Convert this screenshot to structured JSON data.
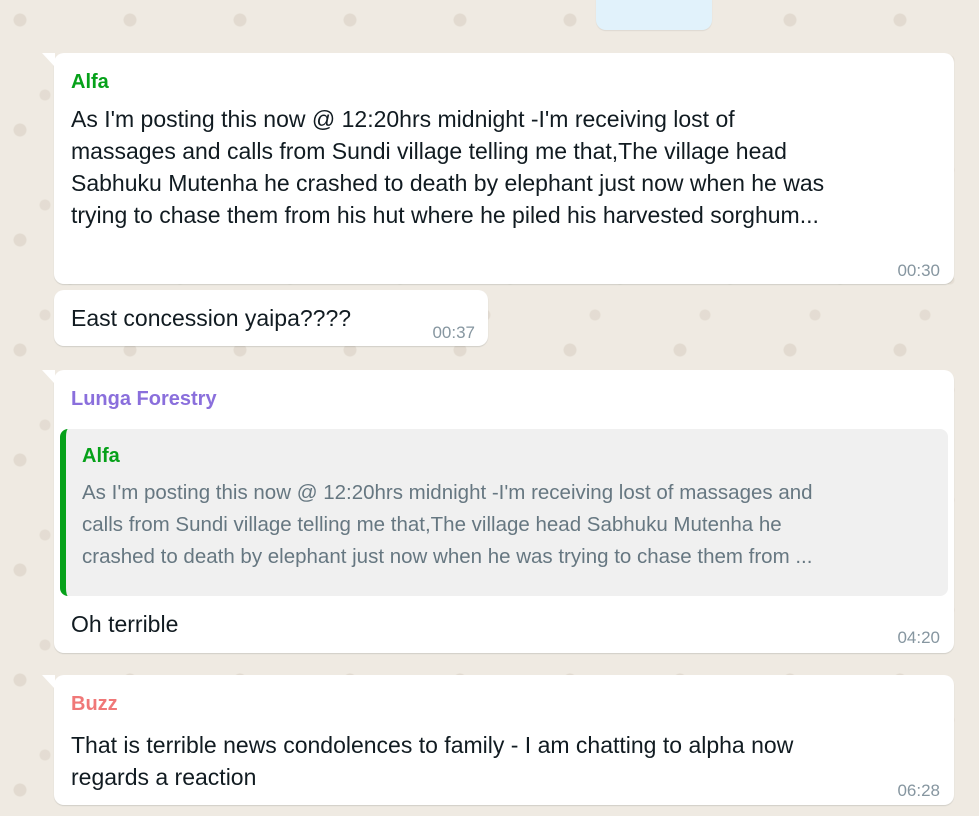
{
  "colors": {
    "alfa": "#06a11a",
    "lunga": "#8a6fdc",
    "buzz": "#f07878",
    "quote_bar": "#06a11a"
  },
  "messages": [
    {
      "sender": "Alfa",
      "lines": [
        "As I'm posting this now @ 12:20hrs midnight -I'm receiving lost of",
        "massages and calls from Sundi village telling me that,The village head",
        "Sabhuku Mutenha he crashed to death by elephant just now when he was",
        "trying to chase them from his hut where he piled his harvested sorghum..."
      ],
      "time": "00:30"
    },
    {
      "text": "East concession yaipa????",
      "time": "00:37"
    },
    {
      "sender": "Lunga Forestry",
      "quote": {
        "sender": "Alfa",
        "lines": [
          "As I'm posting this now @ 12:20hrs midnight -I'm receiving lost of massages and",
          "calls from Sundi village telling me that,The village head Sabhuku Mutenha he",
          "crashed to death by elephant just now when he was trying to chase them from ..."
        ]
      },
      "text": "Oh terrible",
      "time": "04:20"
    },
    {
      "sender": "Buzz",
      "lines": [
        "That is terrible news condolences to family - I am chatting to alpha now",
        "regards a reaction"
      ],
      "time": "06:28"
    }
  ]
}
